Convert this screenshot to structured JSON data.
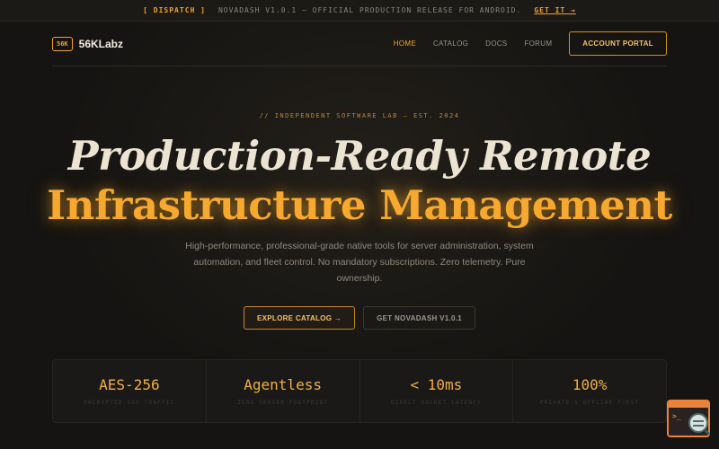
{
  "announcement": {
    "tag": "[ DISPATCH ]",
    "message": "NOVADASH V1.0.1 — OFFICIAL PRODUCTION RELEASE FOR ANDROID.",
    "cta": "GET IT →"
  },
  "brand": {
    "badge": "56K",
    "name": "56KLabz"
  },
  "nav": {
    "items": [
      {
        "label": "HOME",
        "active": true
      },
      {
        "label": "CATALOG",
        "active": false
      },
      {
        "label": "DOCS",
        "active": false
      },
      {
        "label": "FORUM",
        "active": false
      }
    ],
    "portal_label": "ACCOUNT PORTAL"
  },
  "hero": {
    "eyebrow": "// INDEPENDENT SOFTWARE LAB — EST. 2024",
    "title_line1": "Production-Ready Remote",
    "title_line2": "Infrastructure Management",
    "description": "High-performance, professional-grade native tools for server administration, system automation, and fleet control. No mandatory subscriptions. Zero telemetry. Pure ownership.",
    "primary_cta": "EXPLORE CATALOG →",
    "secondary_cta": "GET NOVADASH V1.0.1"
  },
  "stats": [
    {
      "value": "AES-256",
      "label": "ENCRYPTED SSH TRAFFIC"
    },
    {
      "value": "Agentless",
      "label": "ZERO SERVER FOOTPRINT"
    },
    {
      "value": "< 10ms",
      "label": "DIRECT SOCKET LATENCY"
    },
    {
      "value": "100%",
      "label": "PRIVATE & OFFLINE FIRST"
    }
  ],
  "widget": {
    "icon": "terminal-search-icon",
    "terminal_glyph": ">_"
  },
  "colors": {
    "accent": "#f0a32a",
    "background": "#151412",
    "text": "#e9e4d8"
  }
}
